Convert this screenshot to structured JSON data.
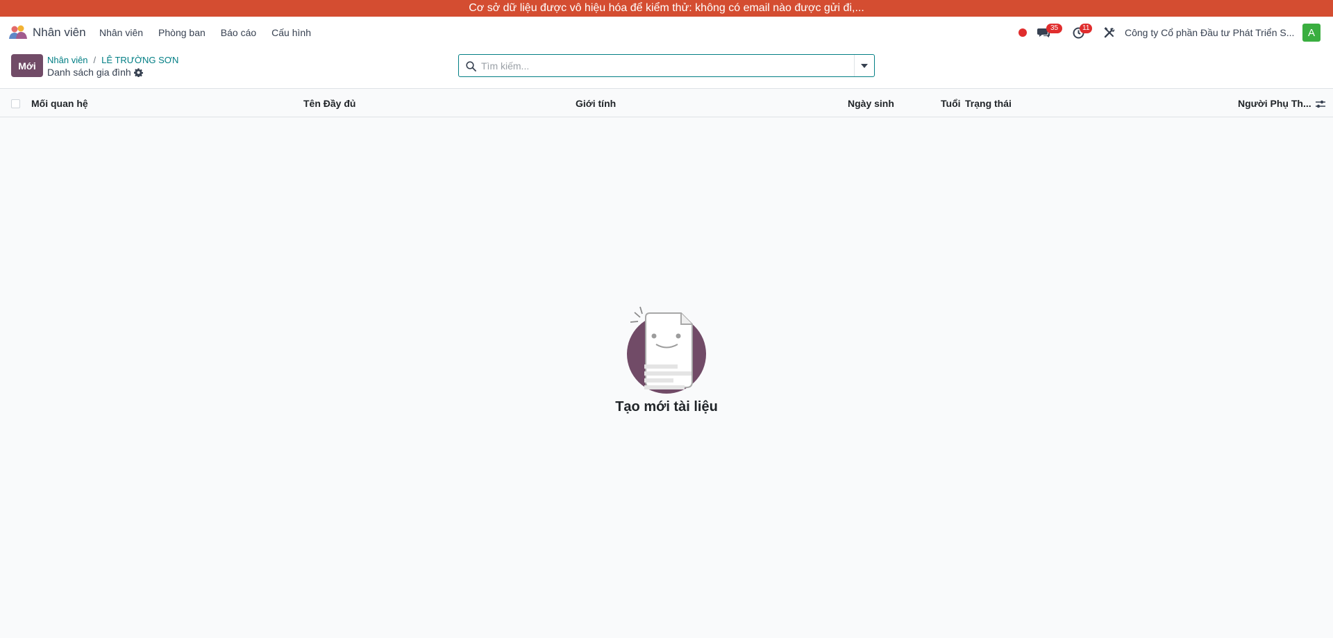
{
  "banner": {
    "text": "Cơ sở dữ liệu được vô hiệu hóa để kiểm thử: không có email nào được gửi đi,..."
  },
  "navbar": {
    "app_name": "Nhân viên",
    "menu": [
      "Nhân viên",
      "Phòng ban",
      "Báo cáo",
      "Cấu hình"
    ],
    "messages_count": "35",
    "activities_count": "11",
    "company": "Công ty Cổ phần Đầu tư Phát Triển S...",
    "avatar_letter": "A",
    "colors": {
      "avatar": "#3aae40",
      "badge": "#e02d2d",
      "record": "#e02d2d"
    }
  },
  "control_panel": {
    "new_label": "Mới",
    "breadcrumb": [
      "Nhân viên",
      "LÊ TRƯỜNG SƠN"
    ],
    "breadcrumb_separator": "/",
    "subtitle": "Danh sách gia đình",
    "search_placeholder": "Tìm kiếm...",
    "colors": {
      "primary": "#714b67",
      "link": "#017e84"
    }
  },
  "table": {
    "columns": [
      "Mối quan hệ",
      "Tên Đầy đủ",
      "Giới tính",
      "Ngày sinh",
      "Tuổi",
      "Trạng thái",
      "Người Phụ Th..."
    ]
  },
  "empty_state": {
    "title": "Tạo mới tài liệu"
  },
  "icons": [
    "app-logo-icon",
    "record-dot-icon",
    "chat-icon",
    "clock-icon",
    "tools-icon",
    "gear-icon",
    "search-icon",
    "caret-down-icon",
    "column-settings-icon",
    "empty-document-icon"
  ]
}
